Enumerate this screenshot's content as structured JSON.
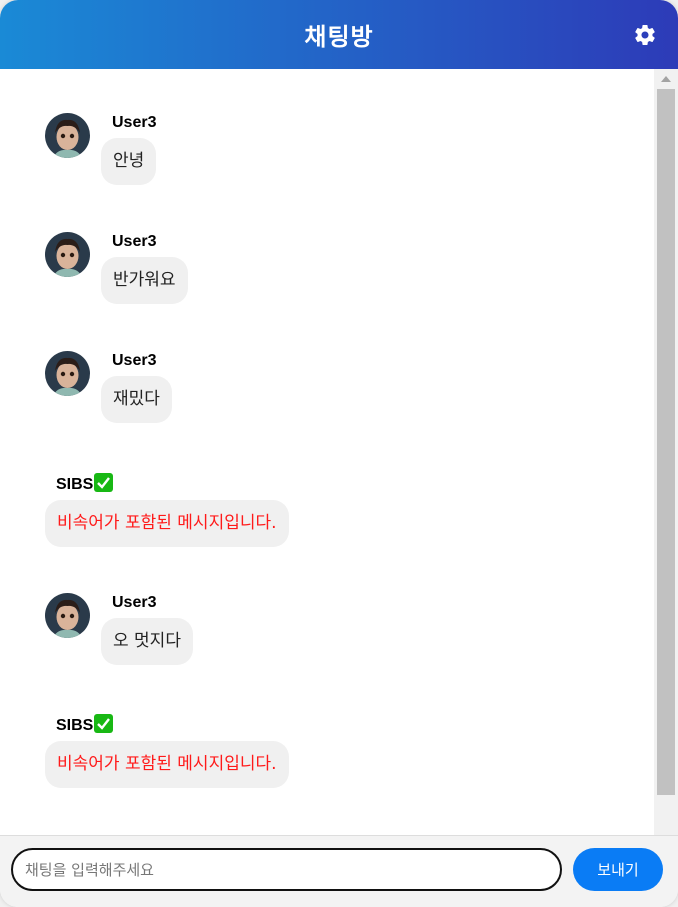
{
  "header": {
    "title": "채팅방",
    "gradient_start": "#1a8ad6",
    "gradient_end": "#2d3bb8",
    "settings_icon": "gear-icon"
  },
  "messages": [
    {
      "type": "user",
      "username": "User3",
      "text": "안녕",
      "avatar": "child-avatar"
    },
    {
      "type": "user",
      "username": "User3",
      "text": "반가워요",
      "avatar": "child-avatar"
    },
    {
      "type": "user",
      "username": "User3",
      "text": "재밌다",
      "avatar": "child-avatar"
    },
    {
      "type": "system",
      "username": "SIBS",
      "badge": "check-mark-icon",
      "text": "비속어가 포함된 메시지입니다."
    },
    {
      "type": "user",
      "username": "User3",
      "text": "오 멋지다",
      "avatar": "child-avatar"
    },
    {
      "type": "system",
      "username": "SIBS",
      "badge": "check-mark-icon",
      "text": "비속어가 포함된 메시지입니다."
    }
  ],
  "composer": {
    "placeholder": "채팅을 입력해주세요",
    "value": "",
    "send_label": "보내기"
  },
  "colors": {
    "warning_text": "#ff1a1a",
    "bubble_bg": "#f0f0f0",
    "send_button": "#0a7cf5",
    "badge_green": "#18b814"
  }
}
